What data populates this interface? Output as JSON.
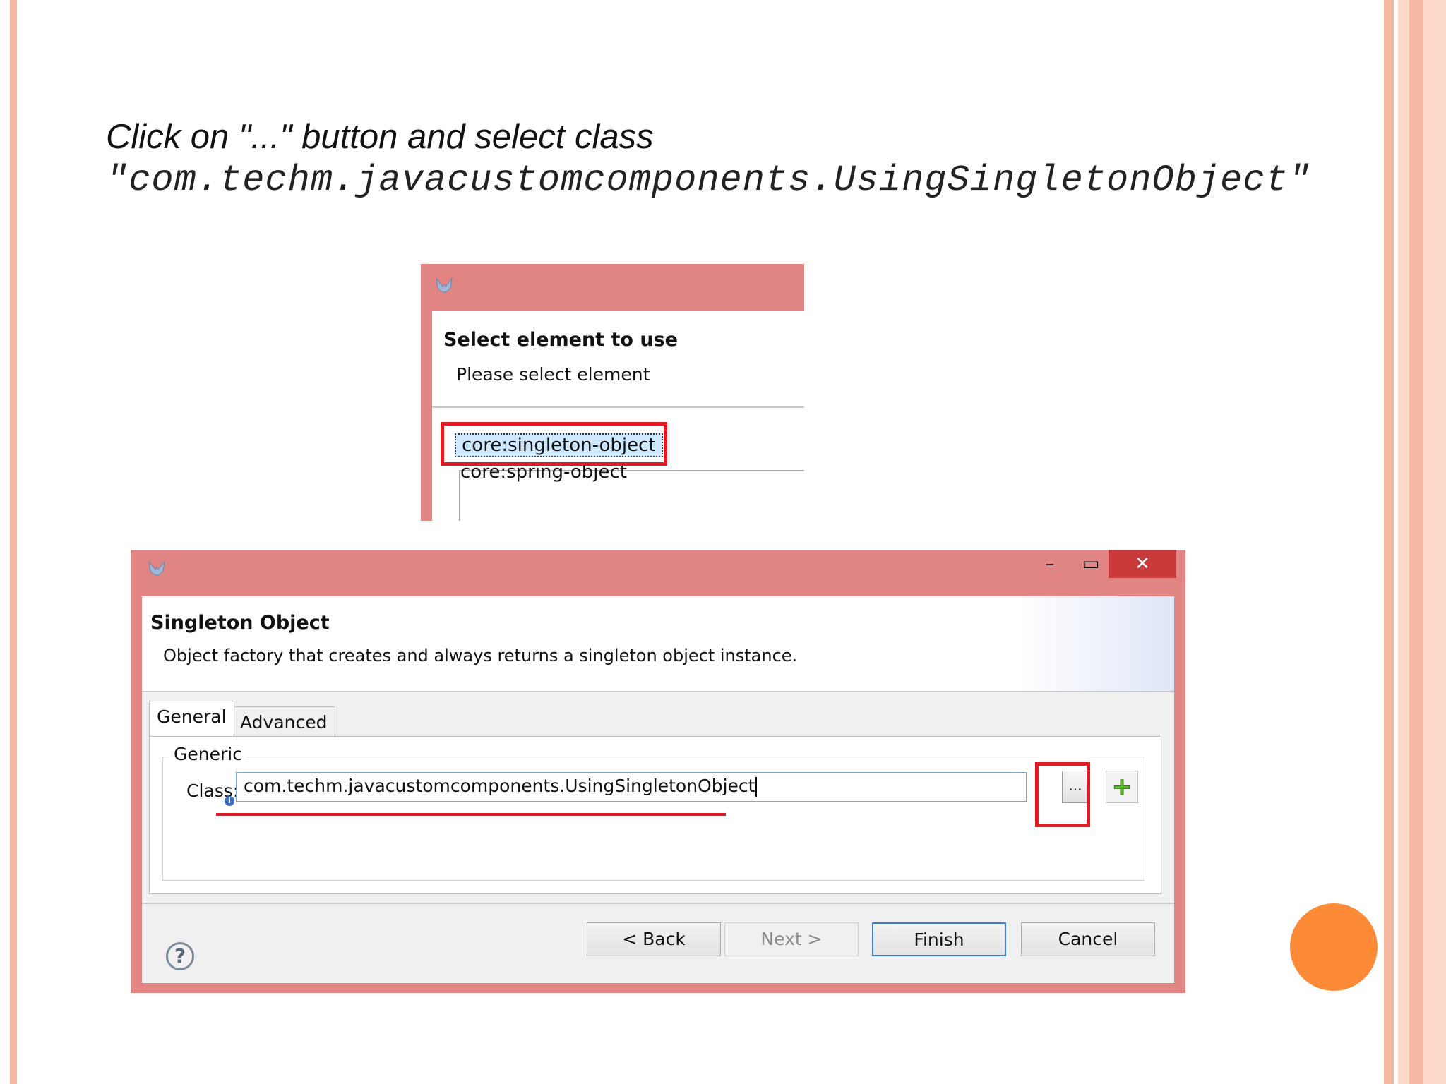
{
  "slide": {
    "instruction_line1": "Click on \"...\" button and select class",
    "instruction_line2": "\"com.techm.javacustomcomponents.UsingSingletonObject\"",
    "colors": {
      "stripe": "#f6b9a4",
      "accent_dot": "#fd8a37",
      "highlight": "#e01b24",
      "titlebar": "#e18484"
    }
  },
  "select_dialog": {
    "title": "Select element to use",
    "subtitle": "Please select element",
    "items": [
      {
        "label": "core:singleton-object",
        "selected": true
      },
      {
        "label": "core:spring-object",
        "selected": false
      }
    ],
    "icon": "app-icon"
  },
  "singleton_dialog": {
    "title": "Singleton Object",
    "description": "Object factory that creates and always returns a singleton object instance.",
    "window_controls": {
      "minimize": "–",
      "maximize": "▭",
      "close": "✕"
    },
    "tabs": [
      {
        "label": "General",
        "active": true
      },
      {
        "label": "Advanced",
        "active": false
      }
    ],
    "group_label": "Generic",
    "class_label": "Class:",
    "class_value": "com.techm.javacustomcomponents.UsingSingletonObject",
    "browse_label": "...",
    "add_icon": "plus-icon",
    "help_icon": "?",
    "buttons": {
      "back": "< Back",
      "next": "Next >",
      "finish": "Finish",
      "cancel": "Cancel"
    }
  }
}
